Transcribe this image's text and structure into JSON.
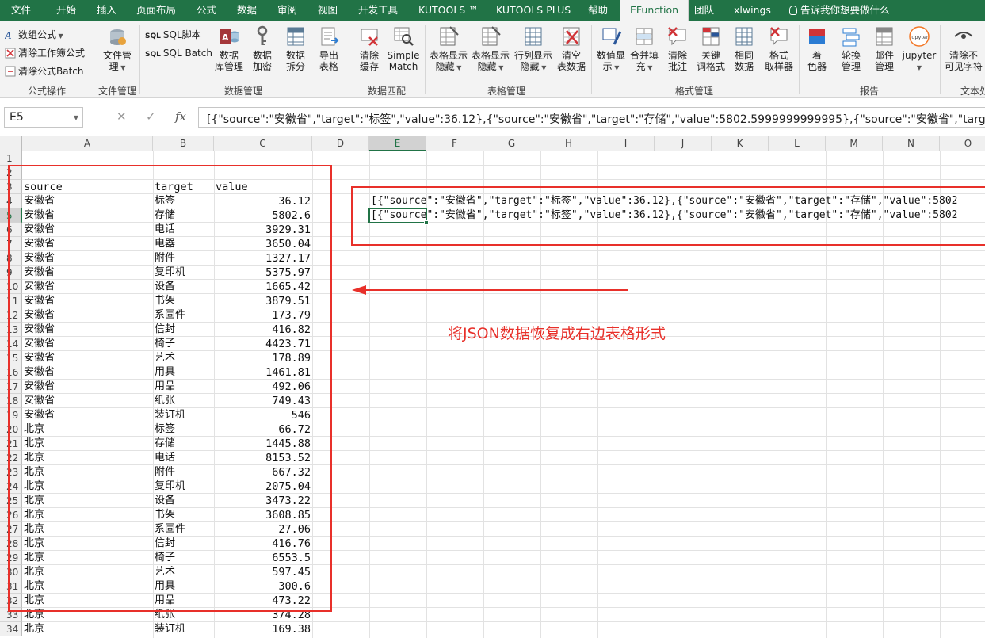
{
  "menu_tabs": [
    "文件",
    "开始",
    "插入",
    "页面布局",
    "公式",
    "数据",
    "审阅",
    "视图",
    "开发工具",
    "KUTOOLS ™",
    "KUTOOLS PLUS",
    "帮助",
    "EFunction",
    "团队",
    "xlwings"
  ],
  "active_tab": "EFunction",
  "tell_me": "告诉我你想要做什么",
  "ribbon": {
    "groups": {
      "formula_ops": "公式操作",
      "file_mgmt": "文件管理",
      "data_mgmt": "数据管理",
      "data_match": "数据匹配",
      "table_mgmt": "表格管理",
      "format_mgmt": "格式管理",
      "report": "报告",
      "text": "文本处"
    },
    "formula_ops_items": [
      "数组公式",
      "清除工作簿公式",
      "清除公式Batch"
    ],
    "file_mgmt_label": [
      "文件管",
      "理"
    ],
    "sql_script": "SQL脚本",
    "sql_batch": "SQL Batch",
    "data_buttons": [
      [
        "数据",
        "库管理"
      ],
      [
        "数据",
        "加密"
      ],
      [
        "数据",
        "拆分"
      ],
      [
        "导出",
        "表格"
      ]
    ],
    "match_buttons": [
      [
        "清除",
        "缓存"
      ],
      [
        "Simple",
        "Match"
      ]
    ],
    "table_buttons": [
      [
        "表格显示",
        "隐藏"
      ],
      [
        "表格显示",
        "隐藏"
      ],
      [
        "行列显示",
        "隐藏"
      ],
      [
        "清空",
        "表数据"
      ]
    ],
    "format_buttons": [
      [
        "数值显",
        "示"
      ],
      [
        "合并填",
        "充"
      ],
      [
        "清除",
        "批注"
      ],
      [
        "关键",
        "词格式"
      ],
      [
        "相同",
        "数据"
      ],
      [
        "格式",
        "取样器"
      ]
    ],
    "report_buttons": [
      [
        "着",
        "色器"
      ],
      [
        "轮换",
        "管理"
      ],
      [
        "邮件",
        "管理"
      ],
      [
        "jupyter",
        ""
      ]
    ],
    "jupyter_logo": "jupyter",
    "text_button": [
      "清除不",
      "可见字符"
    ]
  },
  "formula_bar": {
    "name_box": "E5",
    "formula": "[{\"source\":\"安徽省\",\"target\":\"标签\",\"value\":36.12},{\"source\":\"安徽省\",\"target\":\"存储\",\"value\":5802.5999999999995},{\"source\":\"安徽省\",\"target\""
  },
  "columns": [
    "A",
    "B",
    "C",
    "D",
    "E",
    "F",
    "G",
    "H",
    "I",
    "J",
    "K",
    "L",
    "M",
    "N",
    "O"
  ],
  "selected_column": "E",
  "selected_row": 5,
  "rows": [
    "1",
    "2",
    "3",
    "4",
    "5",
    "6",
    "7",
    "8",
    "9",
    "10",
    "11",
    "12",
    "13",
    "14",
    "15",
    "16",
    "17",
    "18",
    "19",
    "20",
    "21",
    "22",
    "23",
    "24",
    "25",
    "26",
    "27",
    "28",
    "29",
    "30",
    "31",
    "32",
    "33",
    "34"
  ],
  "table_headers": [
    "source",
    "target",
    "value"
  ],
  "table_rows": [
    [
      "安徽省",
      "标签",
      "36.12"
    ],
    [
      "安徽省",
      "存储",
      "5802.6"
    ],
    [
      "安徽省",
      "电话",
      "3929.31"
    ],
    [
      "安徽省",
      "电器",
      "3650.04"
    ],
    [
      "安徽省",
      "附件",
      "1327.17"
    ],
    [
      "安徽省",
      "复印机",
      "5375.97"
    ],
    [
      "安徽省",
      "设备",
      "1665.42"
    ],
    [
      "安徽省",
      "书架",
      "3879.51"
    ],
    [
      "安徽省",
      "系固件",
      "173.79"
    ],
    [
      "安徽省",
      "信封",
      "416.82"
    ],
    [
      "安徽省",
      "椅子",
      "4423.71"
    ],
    [
      "安徽省",
      "艺术",
      "178.89"
    ],
    [
      "安徽省",
      "用具",
      "1461.81"
    ],
    [
      "安徽省",
      "用品",
      "492.06"
    ],
    [
      "安徽省",
      "纸张",
      "749.43"
    ],
    [
      "安徽省",
      "装订机",
      "546"
    ],
    [
      "北京",
      "标签",
      "66.72"
    ],
    [
      "北京",
      "存储",
      "1445.88"
    ],
    [
      "北京",
      "电话",
      "8153.52"
    ],
    [
      "北京",
      "附件",
      "667.32"
    ],
    [
      "北京",
      "复印机",
      "2075.04"
    ],
    [
      "北京",
      "设备",
      "3473.22"
    ],
    [
      "北京",
      "书架",
      "3608.85"
    ],
    [
      "北京",
      "系固件",
      "27.06"
    ],
    [
      "北京",
      "信封",
      "416.76"
    ],
    [
      "北京",
      "椅子",
      "6553.5"
    ],
    [
      "北京",
      "艺术",
      "597.45"
    ],
    [
      "北京",
      "用具",
      "300.6"
    ],
    [
      "北京",
      "用品",
      "473.22"
    ],
    [
      "北京",
      "纸张",
      "374.28"
    ],
    [
      "北京",
      "装订机",
      "169.38"
    ]
  ],
  "json_cells": [
    "[{\"source\":\"安徽省\",\"target\":\"标签\",\"value\":36.12},{\"source\":\"安徽省\",\"target\":\"存储\",\"value\":5802",
    "[{\"source\":\"安徽省\",\"target\":\"标签\",\"value\":36.12},{\"source\":\"安徽省\",\"target\":\"存储\",\"value\":5802"
  ],
  "annotation": "将JSON数据恢复成右边表格形式",
  "colors": {
    "excel_green": "#217346",
    "annotation_red": "#e8302a"
  }
}
